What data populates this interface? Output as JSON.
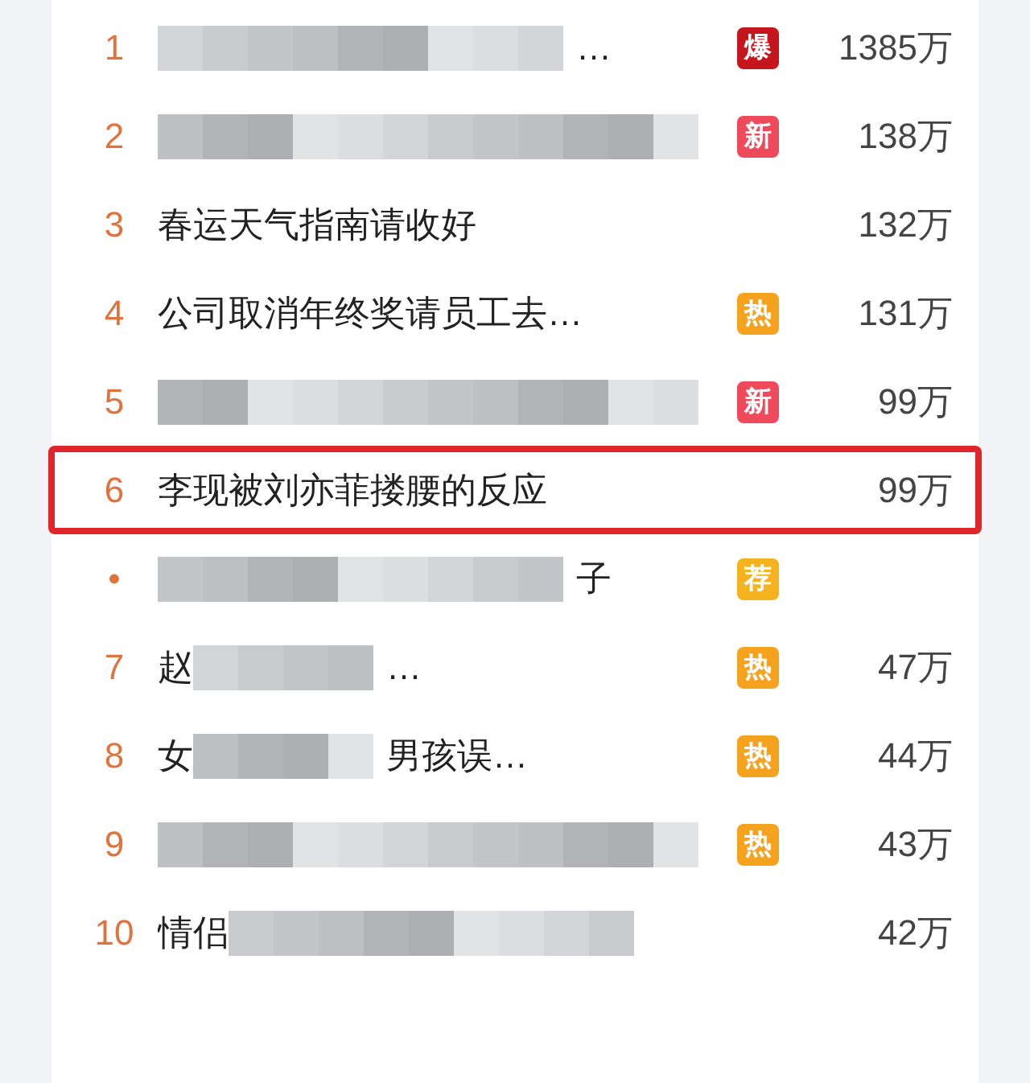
{
  "hot_list": [
    {
      "rank": "1",
      "segments": [
        {
          "kind": "blur"
        },
        {
          "kind": "text",
          "text": "…"
        }
      ],
      "badge": {
        "text": "爆",
        "color": "#c4161c"
      },
      "count": "1385万",
      "selected": false
    },
    {
      "rank": "2",
      "segments": [
        {
          "kind": "blur"
        }
      ],
      "badge": {
        "text": "新",
        "color": "#ee4a5c"
      },
      "count": "138万",
      "selected": false
    },
    {
      "rank": "3",
      "segments": [
        {
          "kind": "text",
          "text": "春运天气指南请收好"
        }
      ],
      "count": "132万",
      "selected": false
    },
    {
      "rank": "4",
      "segments": [
        {
          "kind": "text",
          "text": "公司取消年终奖请员工去…"
        }
      ],
      "badge": {
        "text": "热",
        "color": "#f5a21f"
      },
      "count": "131万",
      "selected": false
    },
    {
      "rank": "5",
      "segments": [
        {
          "kind": "blur"
        }
      ],
      "badge": {
        "text": "新",
        "color": "#ee4a5c"
      },
      "count": "99万",
      "selected": false
    },
    {
      "rank": "6",
      "segments": [
        {
          "kind": "text",
          "text": "李现被刘亦菲搂腰的反应"
        }
      ],
      "count": "99万",
      "selected": true
    },
    {
      "rank": "•",
      "segments": [
        {
          "kind": "blur"
        },
        {
          "kind": "text",
          "text": "子"
        }
      ],
      "badge": {
        "text": "荐",
        "color": "#f5b21f"
      },
      "selected": false
    },
    {
      "rank": "7",
      "segments": [
        {
          "kind": "text",
          "text": "赵"
        },
        {
          "kind": "blur"
        },
        {
          "kind": "text",
          "text": "…"
        }
      ],
      "badge": {
        "text": "热",
        "color": "#f5a21f"
      },
      "count": "47万",
      "selected": false
    },
    {
      "rank": "8",
      "segments": [
        {
          "kind": "text",
          "text": "女"
        },
        {
          "kind": "blur"
        },
        {
          "kind": "text",
          "text": "男孩误…"
        }
      ],
      "badge": {
        "text": "热",
        "color": "#f5a21f"
      },
      "count": "44万",
      "selected": false
    },
    {
      "rank": "9",
      "segments": [
        {
          "kind": "blur"
        }
      ],
      "badge": {
        "text": "热",
        "color": "#f5a21f"
      },
      "count": "43万",
      "selected": false
    },
    {
      "rank": "10",
      "segments": [
        {
          "kind": "text",
          "text": "情侣"
        },
        {
          "kind": "blur"
        }
      ],
      "count": "42万",
      "selected": false
    }
  ]
}
